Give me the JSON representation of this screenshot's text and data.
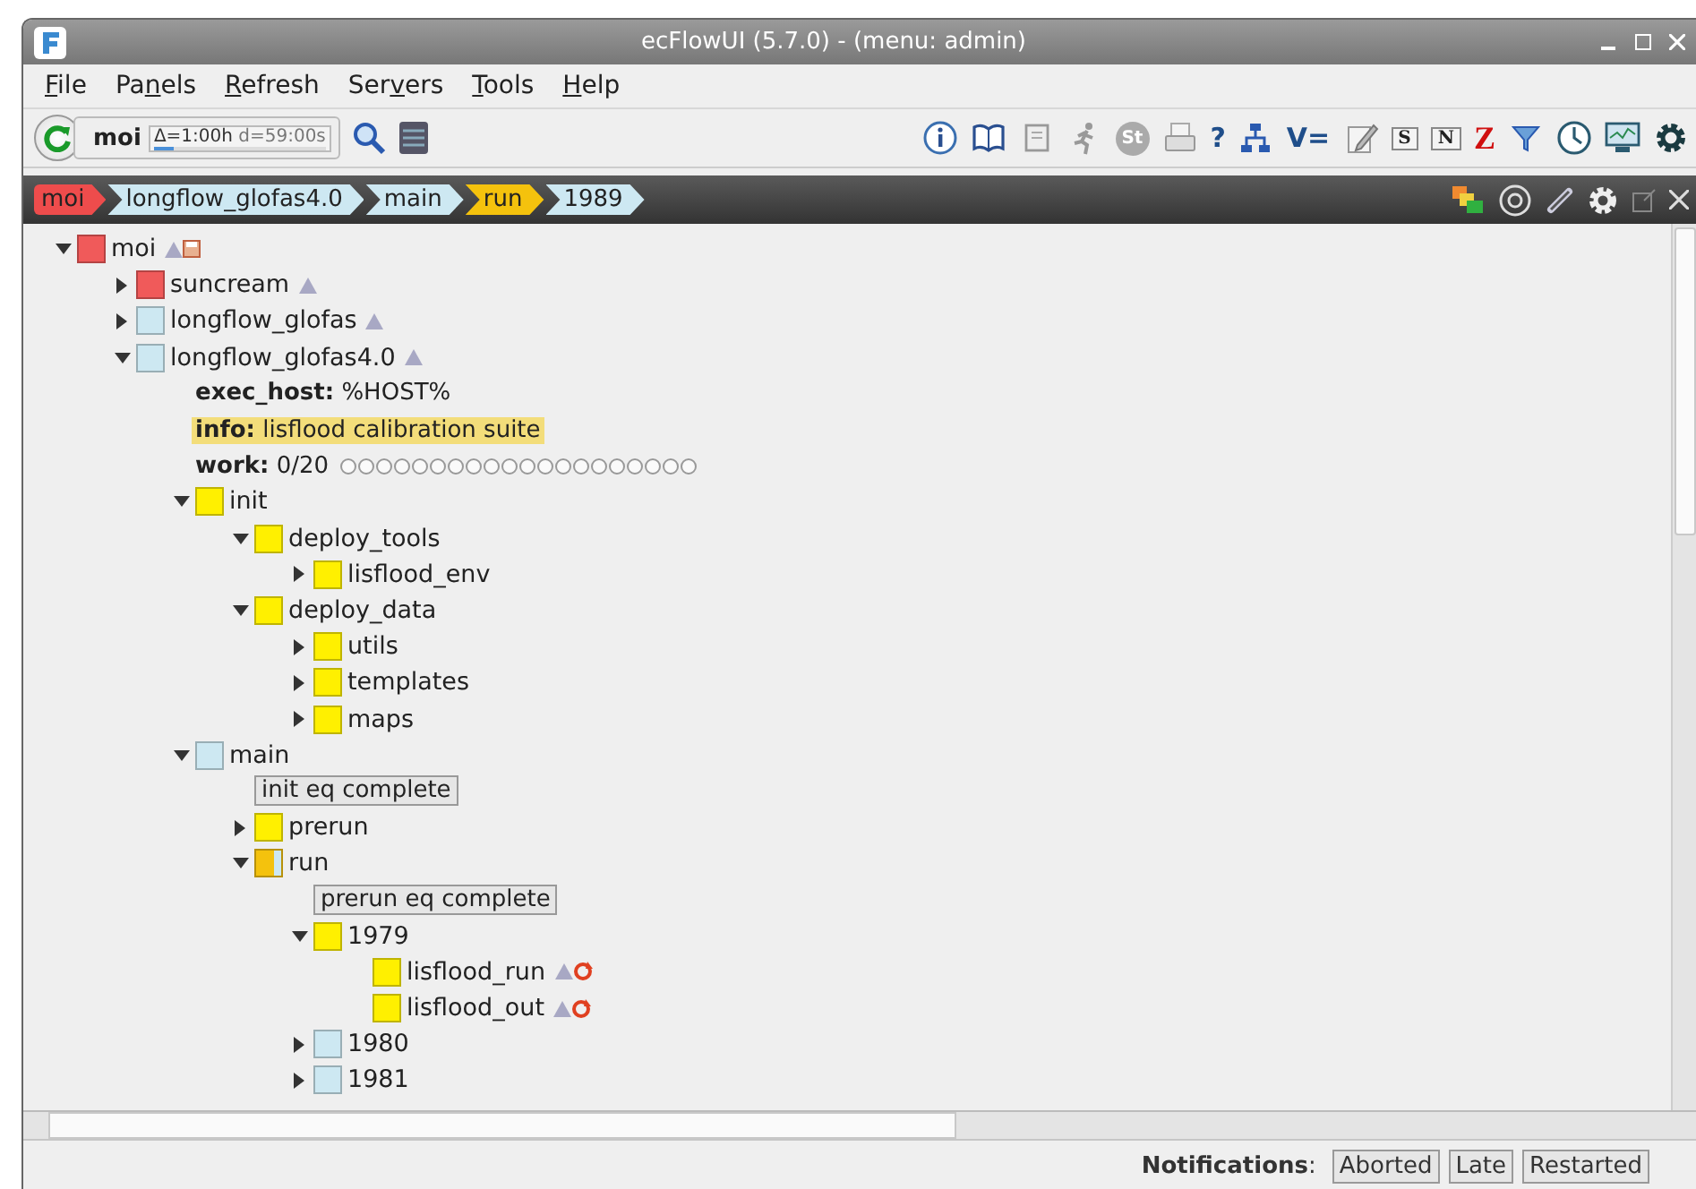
{
  "window": {
    "title": "ecFlowUI (5.7.0) - (menu: admin)"
  },
  "menu": [
    {
      "key": "F",
      "post": "ile"
    },
    {
      "pre": "Pa",
      "key": "n",
      "post": "els"
    },
    {
      "key": "R",
      "post": "efresh"
    },
    {
      "pre": "Ser",
      "key": "v",
      "post": "ers"
    },
    {
      "key": "T",
      "post": "ools"
    },
    {
      "key": "H",
      "post": "elp"
    }
  ],
  "server": {
    "name": "moi",
    "delta": "Δ=1:00h",
    "due": "d=59:00s",
    "level": 0.12
  },
  "toolbar": [
    {
      "kind": "info"
    },
    {
      "kind": "book"
    },
    {
      "kind": "scroll"
    },
    {
      "kind": "runner"
    },
    {
      "kind": "badge",
      "glyph": "St"
    },
    {
      "kind": "printer"
    },
    {
      "kind": "glyph",
      "glyph": "?"
    },
    {
      "kind": "tree"
    },
    {
      "kind": "glyph",
      "glyph": "V="
    },
    {
      "kind": "pencil"
    },
    {
      "kind": "note",
      "glyph": "S"
    },
    {
      "kind": "note",
      "glyph": "N"
    },
    {
      "kind": "zglyph",
      "glyph": "Z"
    },
    {
      "kind": "filter"
    },
    {
      "kind": "clock"
    },
    {
      "kind": "monitor"
    },
    {
      "kind": "gear"
    }
  ],
  "breadcrumb": [
    {
      "label": "moi",
      "color": "#ee4c4c"
    },
    {
      "label": "longflow_glofas4.0",
      "color": "#cde8f2"
    },
    {
      "label": "main",
      "color": "#cde8f2"
    },
    {
      "label": "run",
      "color": "#f4c20d"
    },
    {
      "label": "1989",
      "color": "#cde8f2"
    }
  ],
  "tree": [
    {
      "kind": "node",
      "name": "moi",
      "color": "#f05a5a",
      "expanded": true,
      "flag_marker": true,
      "flag_saved": true,
      "children": [
        {
          "kind": "node",
          "name": "suncream",
          "color": "#f05a5a",
          "expanded": false,
          "flag_marker": true
        },
        {
          "kind": "node",
          "name": "longflow_glofas",
          "color": "#cde8f2",
          "expanded": false,
          "flag_marker": true
        },
        {
          "kind": "node",
          "name": "longflow_glofas4.0",
          "color": "#cde8f2",
          "expanded": true,
          "flag_marker": true,
          "children": [
            {
              "kind": "variable",
              "label": "exec_host:",
              "value": "%HOST%"
            },
            {
              "kind": "info",
              "label": "info:",
              "value": "lisflood calibration suite"
            },
            {
              "kind": "meter",
              "label": "work:",
              "value": "0/20"
            },
            {
              "kind": "node",
              "name": "init",
              "color": "#fff000",
              "expanded": true,
              "children": [
                {
                  "kind": "node",
                  "name": "deploy_tools",
                  "color": "#fff000",
                  "expanded": true,
                  "children": [
                    {
                      "kind": "node",
                      "name": "lisflood_env",
                      "color": "#fff000",
                      "expanded": false
                    }
                  ]
                },
                {
                  "kind": "node",
                  "name": "deploy_data",
                  "color": "#fff000",
                  "expanded": true,
                  "children": [
                    {
                      "kind": "node",
                      "name": "utils",
                      "color": "#fff000",
                      "expanded": false
                    },
                    {
                      "kind": "node",
                      "name": "templates",
                      "color": "#fff000",
                      "expanded": false
                    },
                    {
                      "kind": "node",
                      "name": "maps",
                      "color": "#fff000",
                      "expanded": false
                    }
                  ]
                }
              ]
            },
            {
              "kind": "node",
              "name": "main",
              "color": "#cde8f2",
              "expanded": true,
              "children": [
                {
                  "kind": "trigger",
                  "value": "init eq complete"
                },
                {
                  "kind": "node",
                  "name": "prerun",
                  "color": "#fff000",
                  "expanded": false
                },
                {
                  "kind": "node",
                  "name": "run",
                  "color": "#f4c20d",
                  "substate_strip": true,
                  "expanded": true,
                  "children": [
                    {
                      "kind": "trigger",
                      "value": "prerun eq complete"
                    },
                    {
                      "kind": "node",
                      "name": "1979",
                      "color": "#fff000",
                      "expanded": true,
                      "children": [
                        {
                          "kind": "leaf",
                          "name": "lisflood_run",
                          "color": "#fff000",
                          "flag_marker": true,
                          "flag_rerun": true
                        },
                        {
                          "kind": "leaf",
                          "name": "lisflood_out",
                          "color": "#fff000",
                          "flag_marker": true,
                          "flag_rerun": true
                        }
                      ]
                    },
                    {
                      "kind": "node",
                      "name": "1980",
                      "color": "#cde8f2",
                      "expanded": false
                    },
                    {
                      "kind": "node",
                      "name": "1981",
                      "color": "#cde8f2",
                      "expanded": false
                    }
                  ]
                }
              ]
            }
          ]
        }
      ]
    }
  ],
  "status_bar": {
    "label": "**Notifications**:",
    "buttons": [
      "Aborted",
      "Late",
      "Restarted"
    ]
  }
}
